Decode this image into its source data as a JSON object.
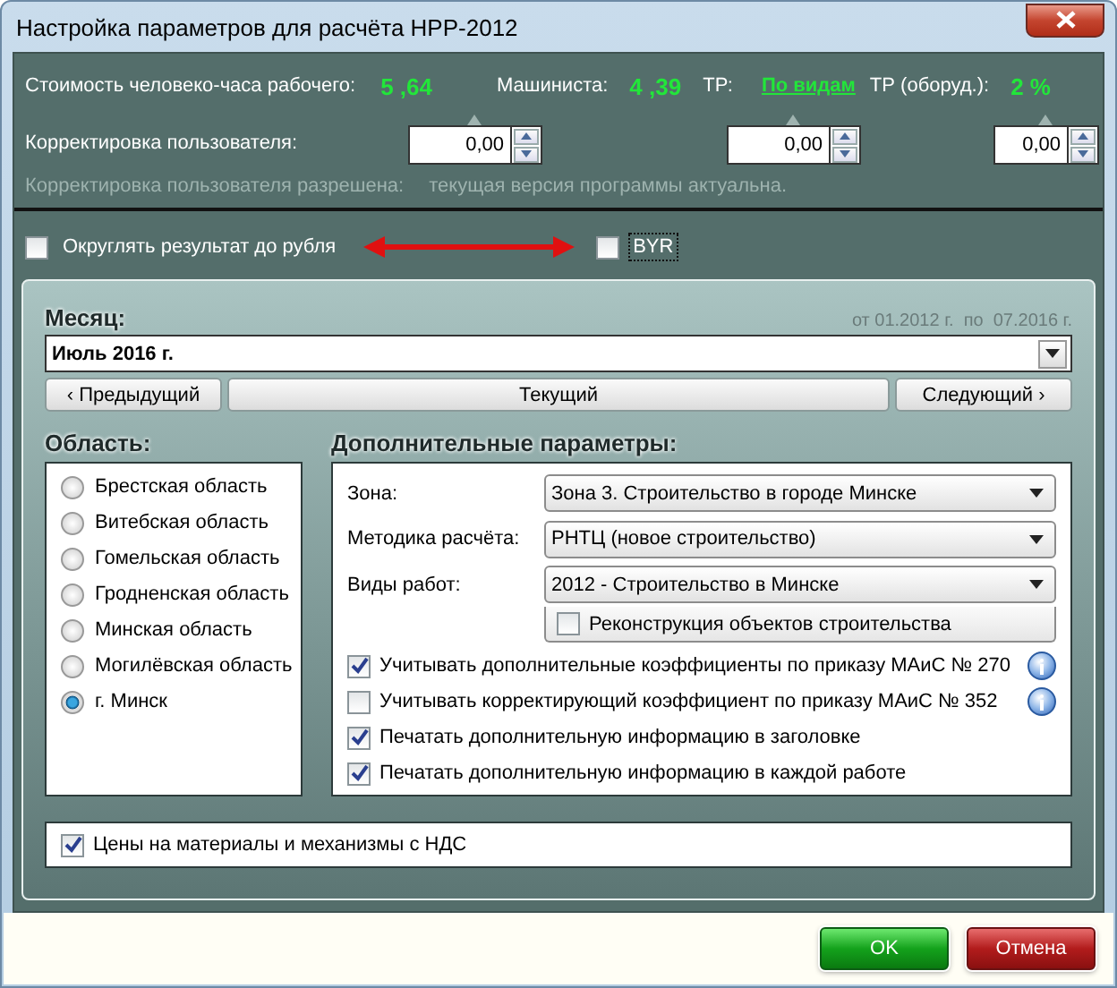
{
  "window": {
    "title": "Настройка параметров для расчёта НРР-2012"
  },
  "rates": [
    {
      "label": "Стоимость человеко-часа рабочего:",
      "value": "5 ,64",
      "kind": "value"
    },
    {
      "label": "Машиниста:",
      "value": "4 ,39",
      "kind": "value"
    },
    {
      "label": "ТР:",
      "value": "По видам",
      "kind": "link"
    },
    {
      "label": "ТР (оборуд.):",
      "value": "2 %",
      "kind": "value"
    }
  ],
  "correction": {
    "label": "Корректировка пользователя:",
    "fields": [
      "0,00",
      "0,00",
      "0,00"
    ]
  },
  "status_note": [
    "Корректировка пользователя разрешена:",
    "текущая версия программы актуальна."
  ],
  "options": [
    {
      "label": "Округлять результат до рубля",
      "checked": false,
      "focused": false
    },
    {
      "label": "BYR",
      "checked": false,
      "focused": true
    }
  ],
  "month": {
    "label": "Месяц:",
    "range": "от 01.2012 г.  по  07.2016 г.",
    "value": "Июль 2016 г.",
    "buttons": [
      {
        "label": "‹ Предыдущий",
        "kind": "prev"
      },
      {
        "label": "Текущий",
        "kind": "current"
      },
      {
        "label": "Следующий ›",
        "kind": "next"
      }
    ]
  },
  "regions": {
    "title": "Область:",
    "items": [
      {
        "label": "Брестская область",
        "selected": false
      },
      {
        "label": "Витебская область",
        "selected": false
      },
      {
        "label": "Гомельская область",
        "selected": false
      },
      {
        "label": "Гродненская область",
        "selected": false
      },
      {
        "label": "Минская область",
        "selected": false
      },
      {
        "label": "Могилёвская область",
        "selected": false
      },
      {
        "label": "г. Минск",
        "selected": true
      }
    ]
  },
  "params": {
    "title": "Дополнительные параметры:",
    "selects": [
      {
        "label": "Зона:",
        "value": "Зона 3. Строительство в городе Минске"
      },
      {
        "label": "Методика расчёта:",
        "value": "РНТЦ (новое строительство)"
      },
      {
        "label": "Виды работ:",
        "value": "2012 - Строительство в Минске"
      }
    ],
    "sub_check": {
      "label": "Реконструкция объектов строительства",
      "checked": false
    },
    "checks": [
      {
        "label": "Учитывать дополнительные коэффициенты по приказу МАиС № 270",
        "checked": true,
        "info": true
      },
      {
        "label": "Учитывать корректирующий коэффициент по приказу МАиС № 352",
        "checked": false,
        "info": true
      },
      {
        "label": "Печатать дополнительную информацию в заголовке",
        "checked": true,
        "info": false
      },
      {
        "label": "Печатать дополнительную информацию в каждой работе",
        "checked": true,
        "info": false
      }
    ]
  },
  "vat": {
    "label": "Цены на материалы и механизмы с НДС",
    "checked": true
  },
  "buttons": [
    {
      "label": "OK",
      "kind": "ok"
    },
    {
      "label": "Отмена",
      "kind": "cancel"
    }
  ]
}
